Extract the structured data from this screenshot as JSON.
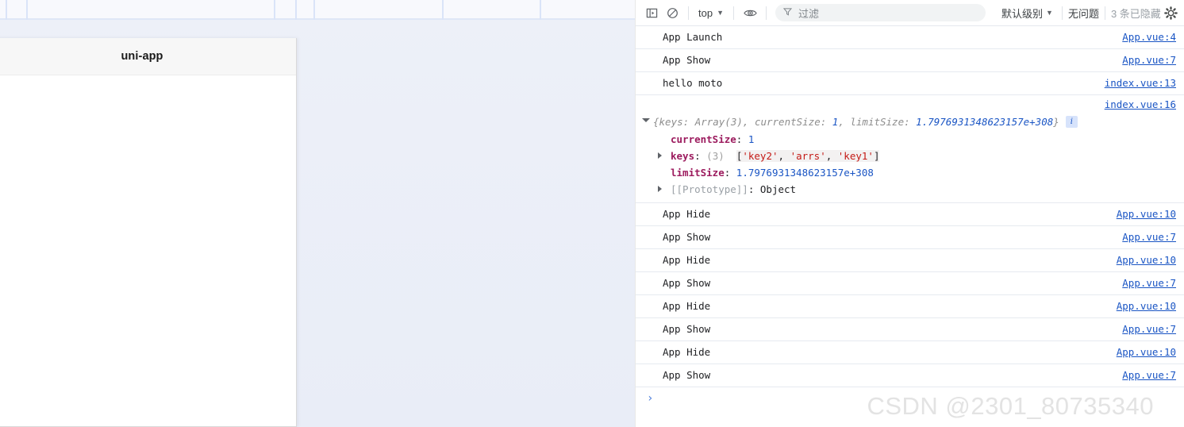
{
  "simulator": {
    "app_title": "uni-app",
    "toolbar_dividers": [
      7,
      33,
      345,
      372,
      395,
      557,
      680
    ]
  },
  "devtools": {
    "toolbar": {
      "sidebar_toggle_icon": "sidebar-toggle-icon",
      "clear_console_icon": "clear-console-icon",
      "context_selector": "top",
      "eye_icon": "live-expression-eye-icon",
      "filter_placeholder": "过滤",
      "filter_icon": "filter-funnel-icon",
      "level_selector": "默认级别",
      "issues_status": "无问题",
      "hidden_count": "3 条已隐藏",
      "settings_icon": "gear-icon"
    },
    "logs": [
      {
        "type": "message",
        "message": "App Launch",
        "source": "App.vue:4"
      },
      {
        "type": "message",
        "message": "App Show",
        "source": "App.vue:7"
      },
      {
        "type": "message",
        "message": "hello moto",
        "source": "index.vue:13"
      },
      {
        "type": "object",
        "source": "index.vue:16",
        "preview": {
          "open_brace": "{",
          "close_brace": "}",
          "entries": [
            {
              "key": "keys",
              "value": "Array(3)",
              "value_kind": "ref"
            },
            {
              "key": "currentSize",
              "value": "1",
              "value_kind": "number"
            },
            {
              "key": "limitSize",
              "value": "1.7976931348623157e+308",
              "value_kind": "number"
            }
          ],
          "badge": "i"
        },
        "properties": [
          {
            "key": "currentSize",
            "kind": "number",
            "value": "1",
            "expandable": false
          },
          {
            "key": "keys",
            "kind": "array",
            "length": "(3)",
            "value": "['key2', 'arrs', 'key1']",
            "items": [
              "'key2'",
              "'arrs'",
              "'key1'"
            ],
            "expandable": true
          },
          {
            "key": "limitSize",
            "kind": "number",
            "value": "1.7976931348623157e+308",
            "expandable": false
          },
          {
            "key": "[[Prototype]]",
            "kind": "proto",
            "value": "Object",
            "expandable": true
          }
        ]
      },
      {
        "type": "message",
        "message": "App Hide",
        "source": "App.vue:10"
      },
      {
        "type": "message",
        "message": "App Show",
        "source": "App.vue:7"
      },
      {
        "type": "message",
        "message": "App Hide",
        "source": "App.vue:10"
      },
      {
        "type": "message",
        "message": "App Show",
        "source": "App.vue:7"
      },
      {
        "type": "message",
        "message": "App Hide",
        "source": "App.vue:10"
      },
      {
        "type": "message",
        "message": "App Show",
        "source": "App.vue:7"
      },
      {
        "type": "message",
        "message": "App Hide",
        "source": "App.vue:10"
      },
      {
        "type": "message",
        "message": "App Show",
        "source": "App.vue:7"
      }
    ],
    "prompt_chevron": "›"
  },
  "watermark": "CSDN @2301_80735340",
  "colors": {
    "link": "#1a55c4",
    "key": "#9c1b5e",
    "string": "#c41a16",
    "preview_italic": "#8d8d8d",
    "panel_bg": "#edf0f8"
  }
}
